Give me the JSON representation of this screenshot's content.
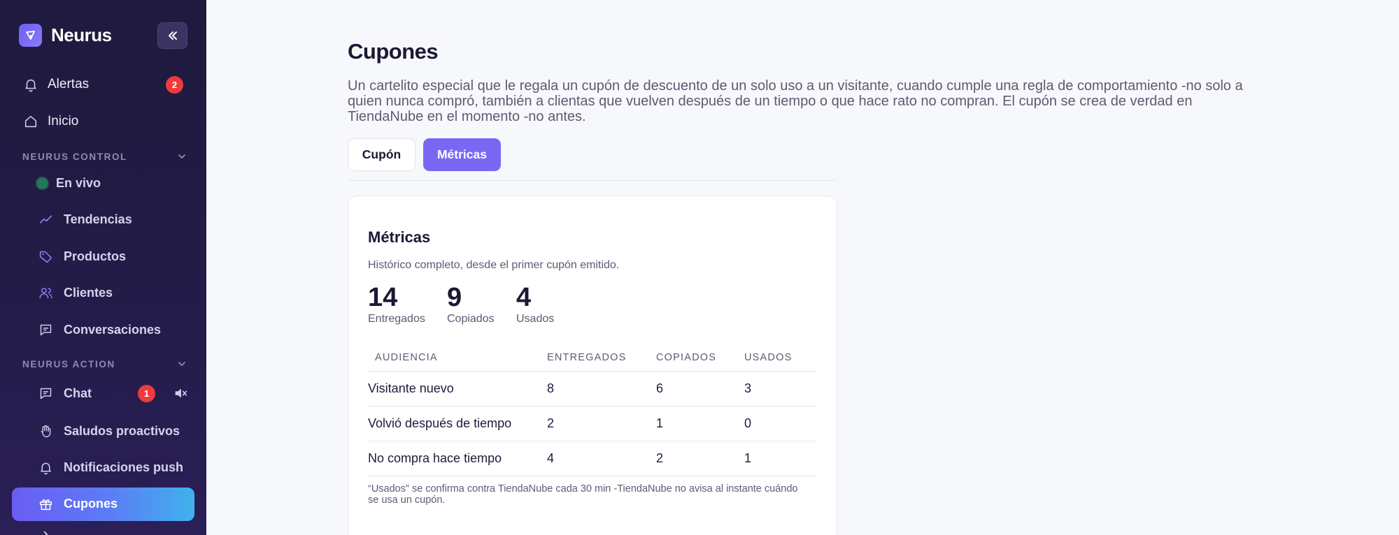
{
  "sidebar": {
    "brand": "Neurus",
    "alerts": {
      "label": "Alertas",
      "count": "2"
    },
    "home": {
      "label": "Inicio"
    },
    "sections": [
      {
        "title": "NEURUS CONTROL",
        "items": [
          {
            "label": "En vivo",
            "icon": "live-dot"
          },
          {
            "label": "Tendencias",
            "icon": "trend-icon"
          },
          {
            "label": "Productos",
            "icon": "tag-icon"
          },
          {
            "label": "Clientes",
            "icon": "users-icon"
          },
          {
            "label": "Conversaciones",
            "icon": "chat-icon"
          }
        ]
      },
      {
        "title": "NEURUS ACTION",
        "items": [
          {
            "label": "Chat",
            "icon": "chat-icon",
            "badge": "1"
          },
          {
            "label": "Saludos proactivos",
            "icon": "hand-icon"
          },
          {
            "label": "Notificaciones push",
            "icon": "bell-icon"
          },
          {
            "label": "Cupones",
            "icon": "gift-icon",
            "active": true
          }
        ]
      }
    ]
  },
  "main": {
    "title": "Cupones",
    "description": "Un cartelito especial que le regala un cupón de descuento de un solo uso a un visitante, cuando cumple una regla de comportamiento -no solo a quien nunca compró, también a clientas que vuelven después de un tiempo o que hace rato no compran. El cupón se crea de verdad en TiendaNube en el momento -no antes.",
    "tabs": [
      {
        "label": "Cupón",
        "active": false
      },
      {
        "label": "Métricas",
        "active": true
      }
    ],
    "card": {
      "title": "Métricas",
      "subtitle": "Histórico completo, desde el primer cupón emitido.",
      "stats": [
        {
          "value": "14",
          "label": "Entregados"
        },
        {
          "value": "9",
          "label": "Copiados"
        },
        {
          "value": "4",
          "label": "Usados"
        }
      ],
      "table": {
        "headers": [
          "AUDIENCIA",
          "ENTREGADOS",
          "COPIADOS",
          "USADOS"
        ],
        "rows": [
          [
            "Visitante nuevo",
            "8",
            "6",
            "3"
          ],
          [
            "Volvió después de tiempo",
            "2",
            "1",
            "0"
          ],
          [
            "No compra hace tiempo",
            "4",
            "2",
            "1"
          ]
        ]
      },
      "footnote": "“Usados” se confirma contra TiendaNube cada 30 min -TiendaNube no avisa al instante cuándo se usa un cupón."
    }
  },
  "colors": {
    "accent": "#7a68f5",
    "badge": "#ef3b3b",
    "sidebar_bg": "#231c48"
  }
}
